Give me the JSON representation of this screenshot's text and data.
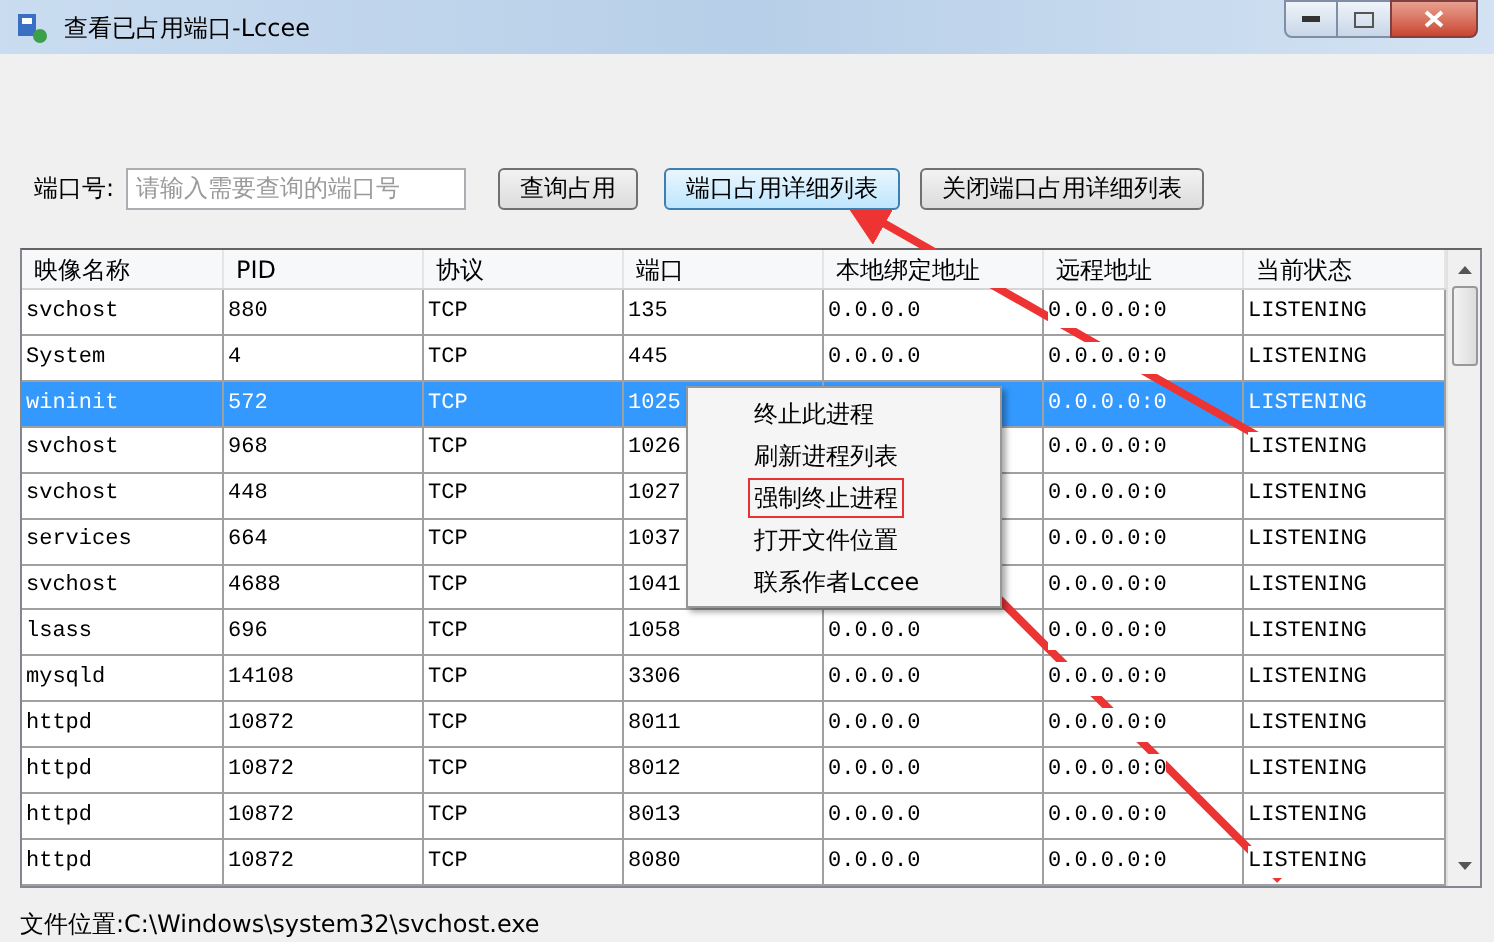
{
  "window": {
    "title": "查看已占用端口-Lccee"
  },
  "search": {
    "label": "端口号:",
    "placeholder": "请输入需要查询的端口号"
  },
  "buttons": [
    {
      "label": "查询占用",
      "focused": false
    },
    {
      "label": "端口占用详细列表",
      "focused": true
    },
    {
      "label": "关闭端口占用详细列表",
      "focused": false
    }
  ],
  "table": {
    "columns": [
      "映像名称",
      "PID",
      "协议",
      "端口",
      "本地绑定地址",
      "远程地址",
      "当前状态"
    ],
    "rows": [
      {
        "name": "svchost",
        "pid": "880",
        "protocol": "TCP",
        "port": "135",
        "local": "0.0.0.0",
        "remote": "0.0.0.0:0",
        "state": "LISTENING",
        "selected": false
      },
      {
        "name": "System",
        "pid": "4",
        "protocol": "TCP",
        "port": "445",
        "local": "0.0.0.0",
        "remote": "0.0.0.0:0",
        "state": "LISTENING",
        "selected": false
      },
      {
        "name": "wininit",
        "pid": "572",
        "protocol": "TCP",
        "port": "1025",
        "remote": "0.0.0.0:0",
        "state": "LISTENING",
        "selected": true
      },
      {
        "name": "svchost",
        "pid": "968",
        "protocol": "TCP",
        "port": "1026",
        "remote": "0.0.0.0:0",
        "state": "LISTENING",
        "selected": false
      },
      {
        "name": "svchost",
        "pid": "448",
        "protocol": "TCP",
        "port": "1027",
        "remote": "0.0.0.0:0",
        "state": "LISTENING",
        "selected": false
      },
      {
        "name": "services",
        "pid": "664",
        "protocol": "TCP",
        "port": "1037",
        "remote": "0.0.0.0:0",
        "state": "LISTENING",
        "selected": false
      },
      {
        "name": "svchost",
        "pid": "4688",
        "protocol": "TCP",
        "port": "1041",
        "remote": "0.0.0.0:0",
        "state": "LISTENING",
        "selected": false
      },
      {
        "name": "lsass",
        "pid": "696",
        "protocol": "TCP",
        "port": "1058",
        "local": "0.0.0.0",
        "remote": "0.0.0.0:0",
        "state": "LISTENING",
        "selected": false
      },
      {
        "name": "mysqld",
        "pid": "14108",
        "protocol": "TCP",
        "port": "3306",
        "local": "0.0.0.0",
        "remote": "0.0.0.0:0",
        "state": "LISTENING",
        "selected": false
      },
      {
        "name": "httpd",
        "pid": "10872",
        "protocol": "TCP",
        "port": "8011",
        "local": "0.0.0.0",
        "remote": "0.0.0.0:0",
        "state": "LISTENING",
        "selected": false
      },
      {
        "name": "httpd",
        "pid": "10872",
        "protocol": "TCP",
        "port": "8012",
        "local": "0.0.0.0",
        "remote": "0.0.0.0:0",
        "state": "LISTENING",
        "selected": false
      },
      {
        "name": "httpd",
        "pid": "10872",
        "protocol": "TCP",
        "port": "8013",
        "local": "0.0.0.0",
        "remote": "0.0.0.0:0",
        "state": "LISTENING",
        "selected": false
      },
      {
        "name": "httpd",
        "pid": "10872",
        "protocol": "TCP",
        "port": "8080",
        "local": "0.0.0.0",
        "remote": "0.0.0.0:0",
        "state": "LISTENING",
        "selected": false
      }
    ]
  },
  "context_menu": {
    "items": [
      {
        "label": "终止此进程",
        "marked": false
      },
      {
        "label": "刷新进程列表",
        "marked": false
      },
      {
        "label": "强制终止进程",
        "marked": true
      },
      {
        "label": "打开文件位置",
        "marked": false
      },
      {
        "label": "联系作者Lccee",
        "marked": false
      }
    ]
  },
  "status_bar": {
    "text": "文件位置:C:\\Windows\\system32\\svchost.exe"
  }
}
